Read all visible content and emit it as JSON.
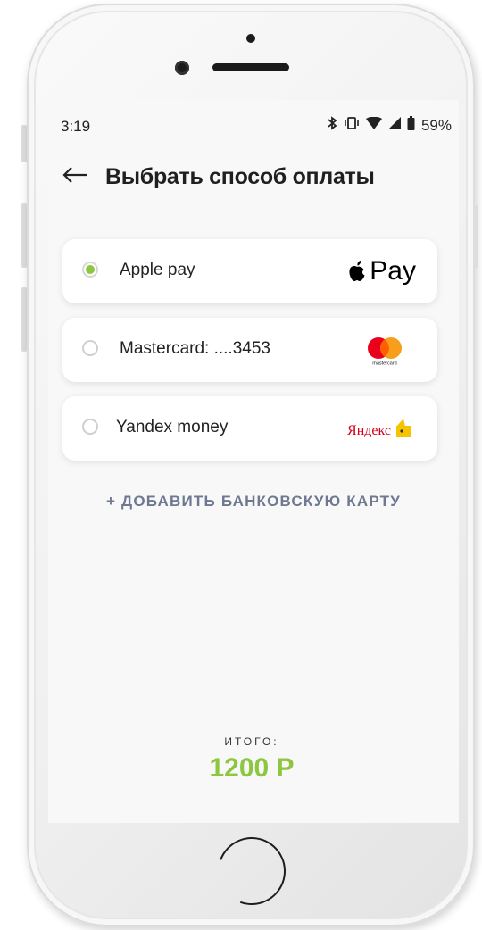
{
  "status_bar": {
    "time": "3:19",
    "battery": "59%"
  },
  "header": {
    "title": "Выбрать способ оплаты"
  },
  "payment_methods": [
    {
      "label": "Apple pay",
      "selected": true,
      "logo": "Pay"
    },
    {
      "label": "Mastercard: ....3453",
      "selected": false,
      "logo": "mastercard"
    },
    {
      "label": "Yandex money",
      "selected": false,
      "logo": "Яндекс"
    }
  ],
  "add_card": {
    "label": "+ ДОБАВИТЬ БАНКОВСКУЮ КАРТУ"
  },
  "total": {
    "label": "ИТОГО:",
    "value": "1200 Р"
  },
  "colors": {
    "accent_green": "#8dc63f",
    "link_gray": "#6e7890"
  }
}
